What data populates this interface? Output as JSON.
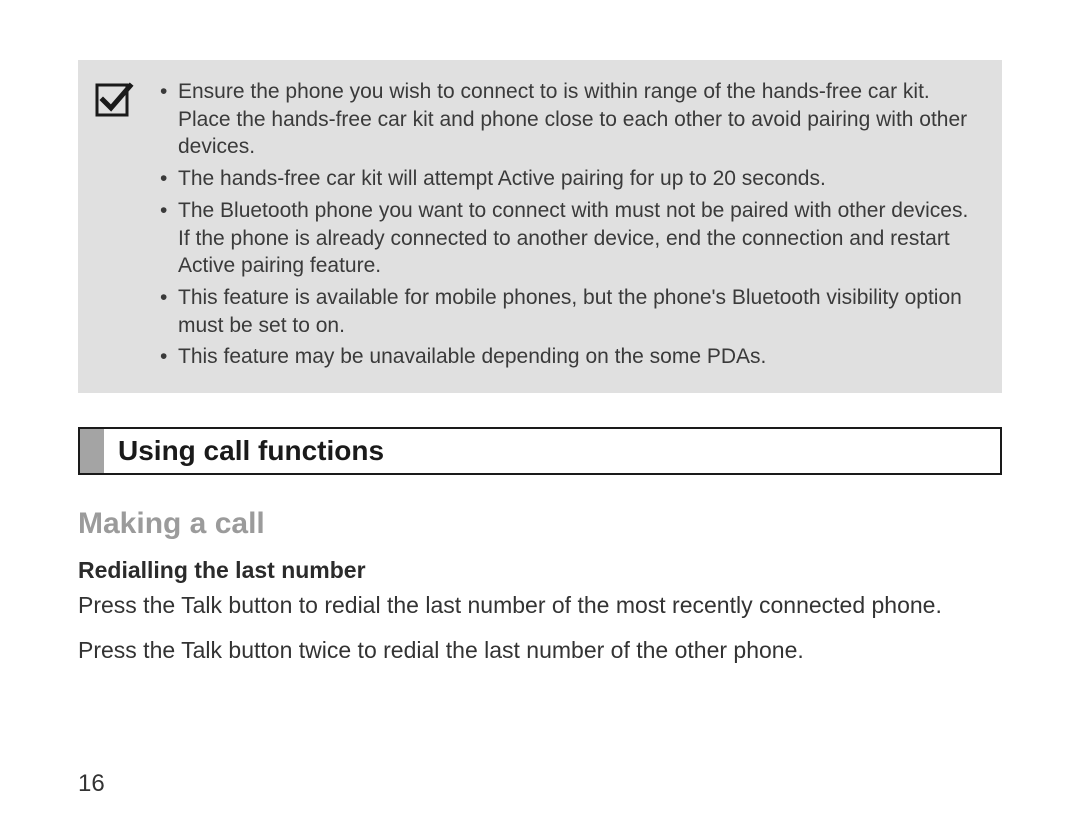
{
  "note": {
    "items": [
      "Ensure the phone you wish to connect to is within range of the hands-free car kit. Place the hands-free car kit and phone close to each other to avoid pairing with other devices.",
      "The hands-free car kit will attempt Active pairing for up to 20 seconds.",
      "The Bluetooth phone you want to connect with must not be paired with other devices. If the phone is already connected to another device, end the connection and restart Active pairing feature.",
      "This feature is available for mobile phones, but the phone's Bluetooth visibility option must be set to on.",
      "This feature may be unavailable depending on the some PDAs."
    ]
  },
  "section_heading": "Using call functions",
  "subheading": "Making a call",
  "subsubheading": "Redialling the last number",
  "paragraphs": [
    "Press the Talk button to redial the last number of the most recently connected phone.",
    "Press the Talk button twice to redial the last number of the other phone."
  ],
  "page_number": "16"
}
